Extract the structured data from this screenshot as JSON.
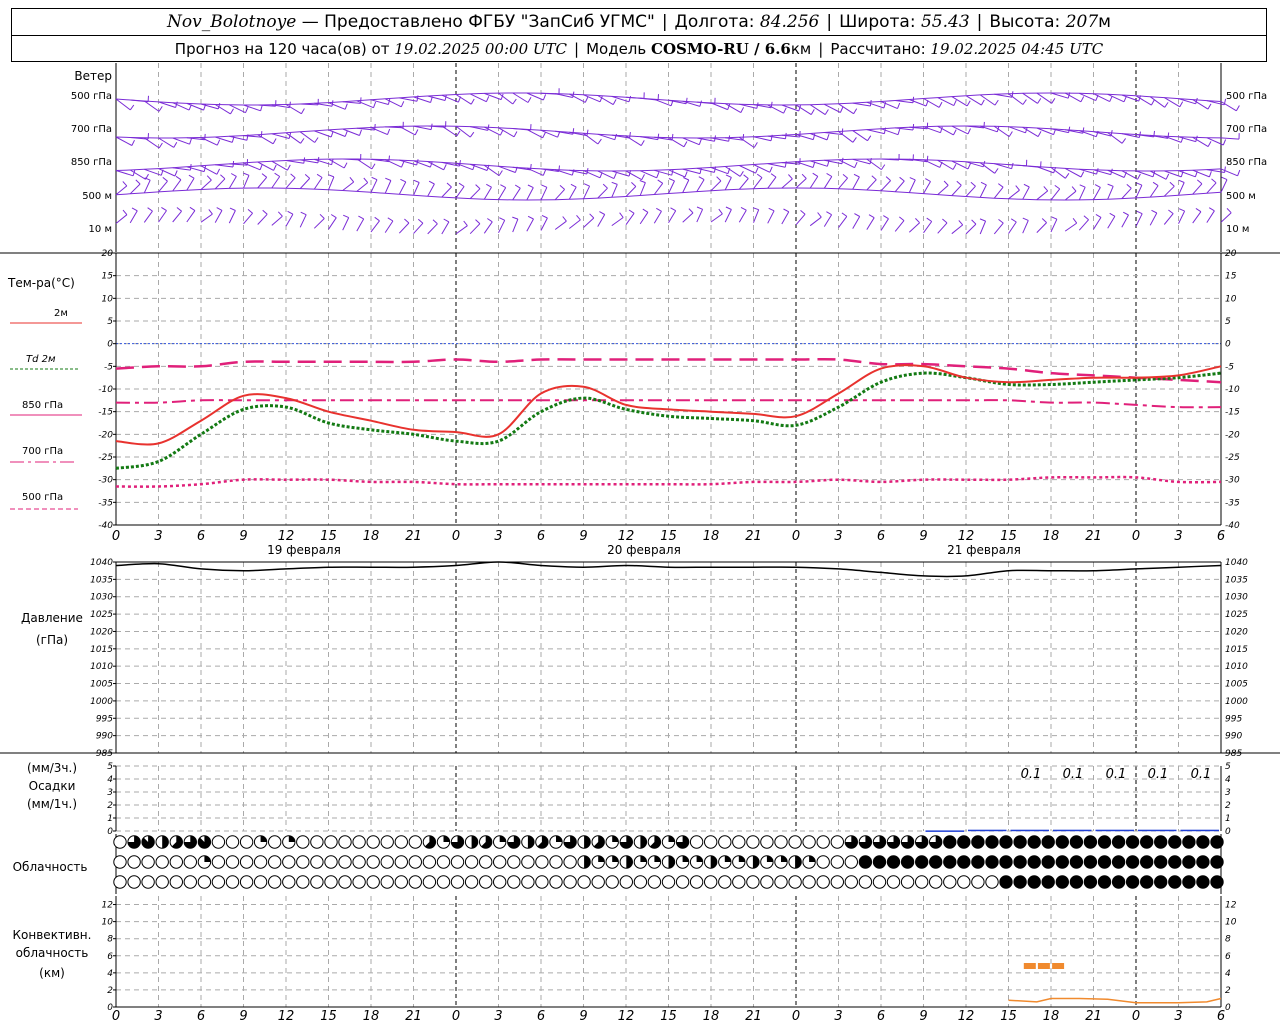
{
  "header": {
    "station": "Nov_Bolotnoye",
    "provider": "— Предоставлено ФГБУ \"ЗапСиб УГМС\"",
    "lon_label": "Долгота:",
    "lon_value": "84.256",
    "lat_label": "Широта:",
    "lat_value": "55.43",
    "alt_label": "Высота:",
    "alt_value": "207",
    "alt_unit": "м",
    "forecast_label": "Прогноз на 120 часа(ов) от",
    "forecast_time": "19.02.2025 00:00 UTC",
    "model_label": "Модель",
    "model_name": "COSMO-RU / 6.6",
    "model_unit": "км",
    "calc_label": "Рассчитано:",
    "calc_time": "19.02.2025 04:45 UTC"
  },
  "x_axis": {
    "hour_labels": [
      "0",
      "3",
      "6",
      "9",
      "12",
      "15",
      "18",
      "21",
      "0",
      "3",
      "6",
      "9",
      "12",
      "15",
      "18",
      "21",
      "0",
      "3",
      "6",
      "9",
      "12",
      "15",
      "18",
      "21",
      "0",
      "3",
      "6"
    ],
    "date_labels": [
      "19 февраля",
      "20 февраля",
      "21 февраля"
    ]
  },
  "wind_panel": {
    "title": "Ветер",
    "levels": [
      "500 гПа",
      "700 гПа",
      "850 гПа",
      "500 м",
      "10 м"
    ],
    "color": "#7a2bd6"
  },
  "temp_panel": {
    "title": "Тем-ра(°C)",
    "legend": [
      {
        "label": "2м",
        "color": "#e8322e",
        "style": "solid"
      },
      {
        "label": "Td  2м",
        "color": "#137a13",
        "style": "dotted"
      },
      {
        "label": "850 гПа",
        "color": "#e0207a",
        "style": "dashdot"
      },
      {
        "label": "700 гПа",
        "color": "#e0207a",
        "style": "dashed"
      },
      {
        "label": "500 гПа",
        "color": "#e0207a",
        "style": "dotted"
      }
    ]
  },
  "pressure_panel": {
    "title": "Давление",
    "unit": "(гПа)"
  },
  "precip_panel": {
    "unit_top": "(мм/3ч.)",
    "title": "Осадки",
    "unit_bottom": "(мм/1ч.)",
    "amount_labels": [
      "0.1",
      "0.1",
      "0.1",
      "0.1",
      "0.1"
    ]
  },
  "cloud_panel": {
    "title": "Облачность"
  },
  "conv_panel": {
    "title1": "Конвективн.",
    "title2": "облачность",
    "unit": "(км)"
  },
  "chart_data": [
    {
      "type": "line",
      "title": "Тем-ра(°C)",
      "x_hours": [
        0,
        3,
        6,
        9,
        12,
        15,
        18,
        21,
        24,
        27,
        30,
        33,
        36,
        39,
        42,
        45,
        48,
        51,
        54,
        57,
        60,
        63,
        66,
        69,
        72,
        75,
        78
      ],
      "ylim": [
        -40,
        20
      ],
      "yticks": [
        -40,
        -35,
        -30,
        -25,
        -20,
        -15,
        -10,
        -5,
        0,
        5,
        10,
        15,
        20
      ],
      "series": [
        {
          "name": "2м",
          "values": [
            -21.5,
            -22,
            -17,
            -11.5,
            -12,
            -15,
            -17,
            -19,
            -19.5,
            -20,
            -11,
            -9.5,
            -13.5,
            -14.5,
            -15,
            -15.5,
            -16,
            -11,
            -5.5,
            -5,
            -7.5,
            -8.5,
            -8,
            -7.5,
            -7.5,
            -7,
            -5
          ]
        },
        {
          "name": "Td  2м",
          "values": [
            -27.5,
            -26,
            -20,
            -14.5,
            -14,
            -17.5,
            -19,
            -20,
            -21.5,
            -21.5,
            -15,
            -12,
            -14.5,
            -16,
            -16.5,
            -17,
            -18,
            -14,
            -8.5,
            -6.5,
            -7.5,
            -9,
            -9,
            -8.5,
            -8,
            -7.5,
            -6.5
          ]
        },
        {
          "name": "850 гПа",
          "values": [
            -13,
            -13,
            -12.5,
            -12.5,
            -12.5,
            -12.5,
            -12.5,
            -12.5,
            -12.5,
            -12.5,
            -12.5,
            -12.5,
            -12.5,
            -12.5,
            -12.5,
            -12.5,
            -12.5,
            -12.5,
            -12.5,
            -12.5,
            -12.5,
            -12.5,
            -13,
            -13,
            -13.5,
            -14,
            -14
          ]
        },
        {
          "name": "700 гПа",
          "values": [
            -5.5,
            -5,
            -5,
            -4,
            -4,
            -4,
            -4,
            -4,
            -3.5,
            -4,
            -3.5,
            -3.5,
            -3.5,
            -3.5,
            -3.5,
            -3.5,
            -3.5,
            -3.5,
            -4.5,
            -4.5,
            -5,
            -5.5,
            -6.5,
            -7,
            -7.5,
            -8,
            -8.5
          ]
        },
        {
          "name": "500 гПа",
          "values": [
            -31.5,
            -31.5,
            -31,
            -30,
            -30,
            -30,
            -30.5,
            -30.5,
            -31,
            -31,
            -31,
            -31,
            -31,
            -31,
            -31,
            -30.5,
            -30.5,
            -30,
            -30.5,
            -30,
            -30,
            -30,
            -29.5,
            -29.5,
            -29.5,
            -30.5,
            -30.5
          ]
        }
      ]
    },
    {
      "type": "line",
      "title": "Давление",
      "x_hours": [
        0,
        3,
        6,
        9,
        12,
        15,
        18,
        21,
        24,
        27,
        30,
        33,
        36,
        39,
        42,
        45,
        48,
        51,
        54,
        57,
        60,
        63,
        66,
        69,
        72,
        75,
        78
      ],
      "ylim": [
        985,
        1040
      ],
      "yticks": [
        985,
        990,
        995,
        1000,
        1005,
        1010,
        1015,
        1020,
        1025,
        1030,
        1035,
        1040
      ],
      "series": [
        {
          "name": "Давление",
          "values": [
            1039,
            1039.5,
            1038,
            1037.5,
            1038,
            1038.5,
            1038.5,
            1038.5,
            1039,
            1040,
            1039,
            1038.5,
            1039,
            1038.5,
            1038.5,
            1038.5,
            1038.5,
            1038,
            1037,
            1036,
            1036,
            1037.5,
            1037.5,
            1037.5,
            1038,
            1038.5,
            1039
          ]
        }
      ]
    },
    {
      "type": "bar",
      "title": "Осадки",
      "x_hours": [
        60,
        63,
        66,
        69,
        72,
        75,
        78
      ],
      "ylim": [
        0,
        5
      ],
      "yticks": [
        0,
        1,
        2,
        3,
        4,
        5
      ],
      "values": [
        0.05,
        0.1,
        0.1,
        0.1,
        0.1,
        0.1,
        0.1
      ]
    },
    {
      "type": "line",
      "title": "Конвективн. облачность",
      "ylim": [
        0,
        13
      ],
      "yticks": [
        0,
        2,
        4,
        6,
        8,
        10,
        12
      ],
      "series": [
        {
          "name": "base",
          "x_hours": [
            63,
            65,
            66,
            68,
            70,
            72,
            75,
            77,
            78
          ],
          "values": [
            0.8,
            0.6,
            1,
            1,
            0.9,
            0.5,
            0.5,
            0.6,
            1
          ]
        },
        {
          "name": "top",
          "x_hours": [
            64.5,
            65.5,
            66.5
          ],
          "values": [
            4.8,
            4.8,
            4.8
          ]
        }
      ]
    }
  ]
}
